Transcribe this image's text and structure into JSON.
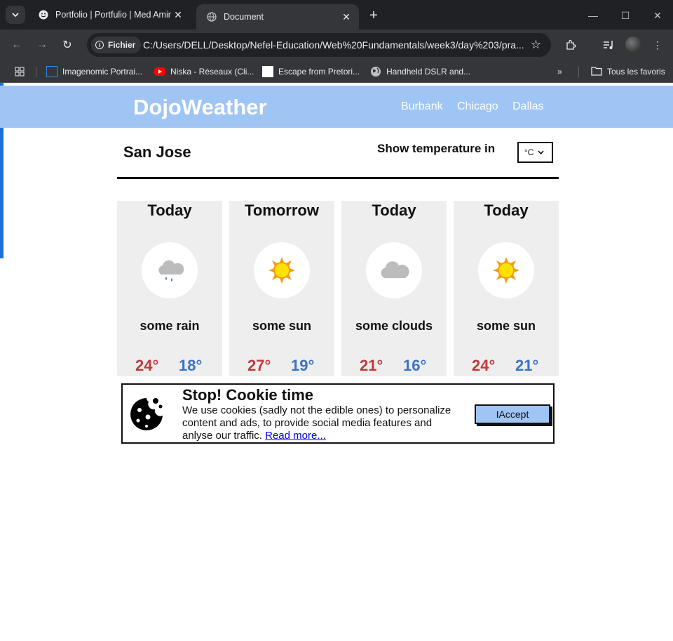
{
  "browser": {
    "tabs": [
      {
        "title": "Portfolio | Portfulio | Med Amine",
        "active": false
      },
      {
        "title": "Document",
        "active": true
      }
    ],
    "url_chip": "Fichier",
    "url": "C:/Users/DELL/Desktop/Nefel-Education/Web%20Fundamentals/week3/day%203/pra...",
    "bookmarks": [
      {
        "label": "Imagenomic Portrai...",
        "icon": "square-outline-icon"
      },
      {
        "label": "Niska - Réseaux (Cli...",
        "icon": "youtube-icon"
      },
      {
        "label": "Escape from Pretori...",
        "icon": "white-square-icon"
      },
      {
        "label": "Handheld DSLR and...",
        "icon": "globe-icon"
      }
    ],
    "all_bookmarks": "Tous les favoris"
  },
  "site": {
    "logo": "DojoWeather",
    "nav": [
      "Burbank",
      "Chicago",
      "Dallas"
    ]
  },
  "main": {
    "city": "San Jose",
    "show_temp_label": "Show temperature in",
    "unit": "°C",
    "forecast": [
      {
        "day": "Today",
        "icon": "rain-cloud-icon",
        "condition": "some rain",
        "high": "24°",
        "low": "18°"
      },
      {
        "day": "Tomorrow",
        "icon": "sun-icon",
        "condition": "some sun",
        "high": "27°",
        "low": "19°"
      },
      {
        "day": "Today",
        "icon": "cloud-icon",
        "condition": "some clouds",
        "high": "21°",
        "low": "16°"
      },
      {
        "day": "Today",
        "icon": "sun-icon",
        "condition": "some sun",
        "high": "24°",
        "low": "21°"
      }
    ],
    "colors": {
      "header": "#9ec5f4",
      "high": "#c0393b",
      "low": "#3a72c4",
      "card": "#eeeeee"
    }
  },
  "cookie": {
    "title": "Stop! Cookie time",
    "text": "We use cookies (sadly not the edible ones) to personalize content and ads, to provide social media features and anlyse our traffic.",
    "link": "Read more...",
    "button": "IAccept"
  }
}
